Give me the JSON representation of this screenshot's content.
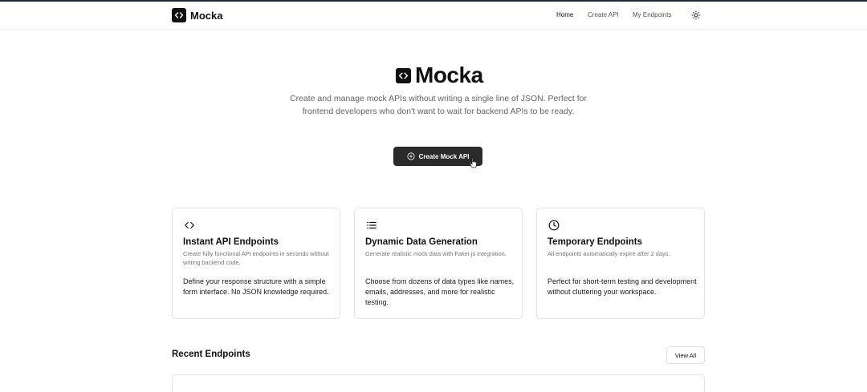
{
  "nav": {
    "brand": "Mocka",
    "links": [
      "Home",
      "Create API",
      "My Endpoints"
    ],
    "theme_icon": "sun-icon"
  },
  "hero": {
    "title": "Mocka",
    "description": "Create and manage mock APIs without writing a single line of JSON. Perfect for frontend developers who don't want to wait for backend APIs to be ready.",
    "cta_label": "Create Mock API",
    "cta_icon": "plus-circle-icon"
  },
  "features": [
    {
      "icon": "code-icon",
      "title": "Instant API Endpoints",
      "subtitle": "Create fully functional API endpoints in seconds without writing backend code.",
      "body": "Define your response structure with a simple form interface. No JSON knowledge required."
    },
    {
      "icon": "list-icon",
      "title": "Dynamic Data Generation",
      "subtitle": "Generate realistic mock data with Faker.js integration.",
      "body": "Choose from dozens of data types like names, emails, addresses, and more for realistic testing."
    },
    {
      "icon": "clock-icon",
      "title": "Temporary Endpoints",
      "subtitle": "All endpoints automatically expire after 2 days.",
      "body": "Perfect for short-term testing and development without cluttering your workspace."
    }
  ],
  "recent": {
    "title": "Recent Endpoints",
    "view_all_label": "View All"
  },
  "colors": {
    "primary": "#2b2b2b",
    "text_muted": "#666666",
    "border": "#e5e5e5"
  }
}
